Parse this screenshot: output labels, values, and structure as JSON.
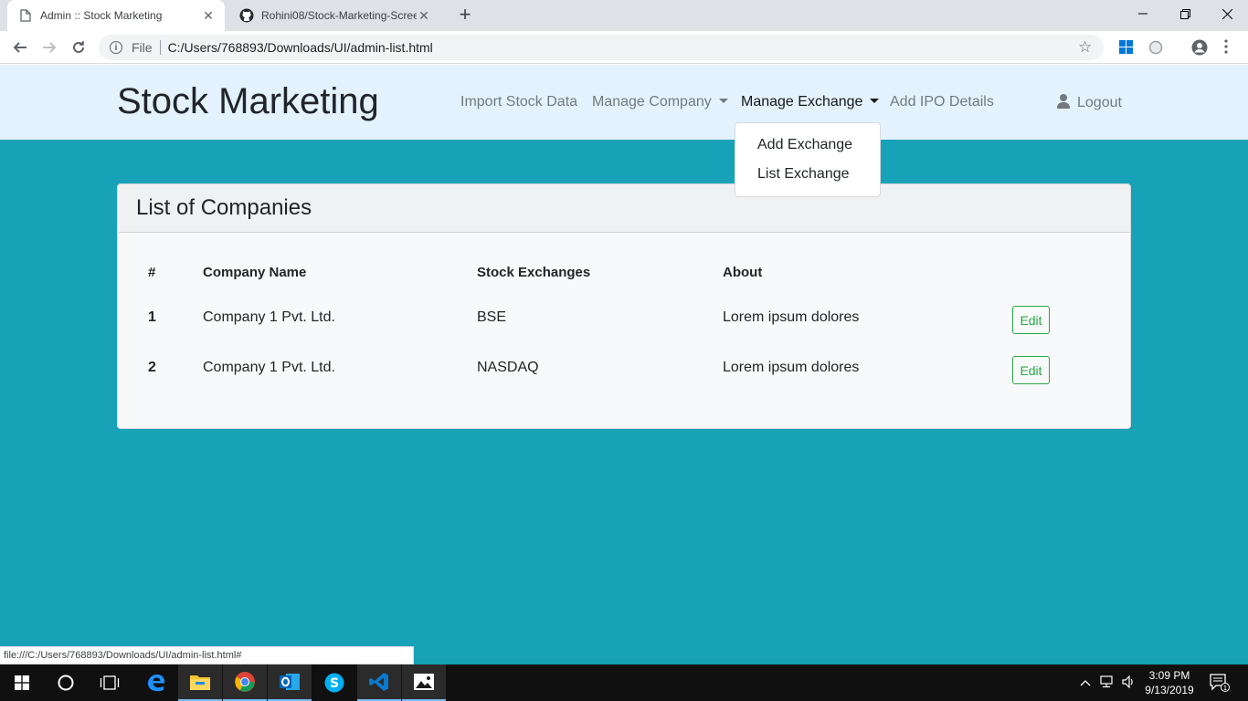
{
  "browser": {
    "tabs": [
      {
        "title": "Admin :: Stock Marketing",
        "icon": "page-icon"
      },
      {
        "title": "Rohini08/Stock-Marketing-Scree",
        "icon": "github-icon"
      }
    ],
    "new_tab": "+",
    "window_controls": {
      "minimize": "—",
      "restore": "❐",
      "close": "✕"
    },
    "address": {
      "scheme": "File",
      "url": "C:/Users/768893/Downloads/UI/admin-list.html"
    },
    "status_url": "file:///C:/Users/768893/Downloads/UI/admin-list.html#"
  },
  "navbar": {
    "brand": "Stock Marketing",
    "links": {
      "import": "Import Stock Data",
      "manage_company": "Manage Company",
      "manage_exchange": "Manage Exchange",
      "add_ipo": "Add IPO Details",
      "logout": "Logout"
    },
    "dropdown": {
      "items": [
        "Add Exchange",
        "List Exchange"
      ]
    }
  },
  "card": {
    "title": "List of Companies",
    "columns": [
      "#",
      "Company Name",
      "Stock Exchanges",
      "About"
    ],
    "rows": [
      {
        "num": "1",
        "company": "Company 1 Pvt. Ltd.",
        "exchange": "BSE",
        "about": "Lorem ipsum dolores",
        "action": "Edit"
      },
      {
        "num": "2",
        "company": "Company 1 Pvt. Ltd.",
        "exchange": "NASDAQ",
        "about": "Lorem ipsum dolores",
        "action": "Edit"
      }
    ]
  },
  "taskbar": {
    "time": "3:09 PM",
    "date": "9/13/2019",
    "notification_count": "1"
  },
  "colors": {
    "page_bg": "#17a2b8",
    "navbar_bg": "#e3f2fd",
    "edit_green": "#28a745"
  }
}
